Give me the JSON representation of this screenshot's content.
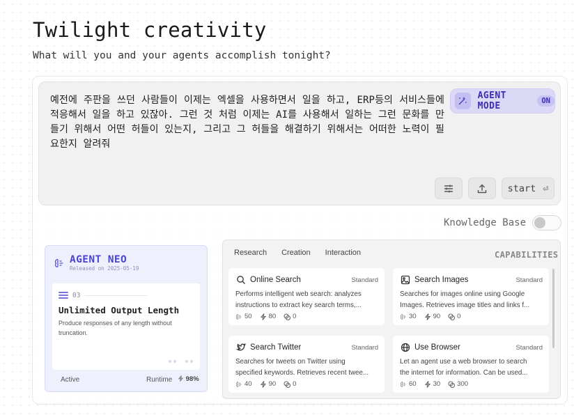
{
  "header": {
    "title": "Twilight creativity",
    "subtitle": "What will you and your agents accomplish tonight?"
  },
  "prompt": {
    "text": "예전에 주판을 쓰던 사람들이 이제는 엑셀을 사용하면서 일을 하고, ERP등의 서비스들에 적응해서 일을 하고 있잖아. 그런 것 처럼 이제는 AI를 사용해서 일하는 그런 문화를 만들기 위해서 어떤 허들이 있는지, 그리고 그 허들을 해결하기 위해서는 어떠한 노력이 필요한지 알려줘",
    "agent_mode_label": "AGENT MODE",
    "agent_mode_state": "ON",
    "start_label": "start",
    "start_shortcut": "⏎"
  },
  "knowledge_base": {
    "label": "Knowledge Base",
    "enabled": false
  },
  "agent_card": {
    "name": "AGENT NEO",
    "released": "Released on 2025-05-19",
    "feature_index": "03",
    "feature_title": "Unlimited Output Length",
    "feature_desc": "Produce responses of any length without truncation.",
    "status": "Active",
    "runtime_label": "Runtime",
    "runtime_value": "98%"
  },
  "capabilities": {
    "label": "CAPABILITIES",
    "tabs": [
      "Research",
      "Creation",
      "Interaction"
    ],
    "cards": [
      {
        "name": "Online Search",
        "tier": "Standard",
        "icon": "search-icon",
        "desc1": "Performs intelligent web search: analyzes",
        "desc2": "instructions to extract key search terms,...",
        "stat1": "50",
        "stat2": "80",
        "stat3": "0"
      },
      {
        "name": "Search Images",
        "tier": "Standard",
        "icon": "image-icon",
        "desc1": "Searches for images online using Google",
        "desc2": "Images. Retrieves image titles and links f...",
        "stat1": "30",
        "stat2": "90",
        "stat3": "0"
      },
      {
        "name": "Search Twitter",
        "tier": "Standard",
        "icon": "twitter-icon",
        "desc1": "Searches for tweets on Twitter using",
        "desc2": "specified keywords. Retrieves recent twee...",
        "stat1": "40",
        "stat2": "90",
        "stat3": "0"
      },
      {
        "name": "Use Browser",
        "tier": "Standard",
        "icon": "globe-icon",
        "desc1": "Let an agent use a web browser to search",
        "desc2": "the internet for information. Can be used...",
        "stat1": "60",
        "stat2": "30",
        "stat3": "300"
      }
    ]
  },
  "colors": {
    "accent": "#4b44d1",
    "agent_mode_bg": "#dcd9f7",
    "agent_card_bg": "#eef0fd",
    "panel_bg": "#f3f3f4"
  }
}
